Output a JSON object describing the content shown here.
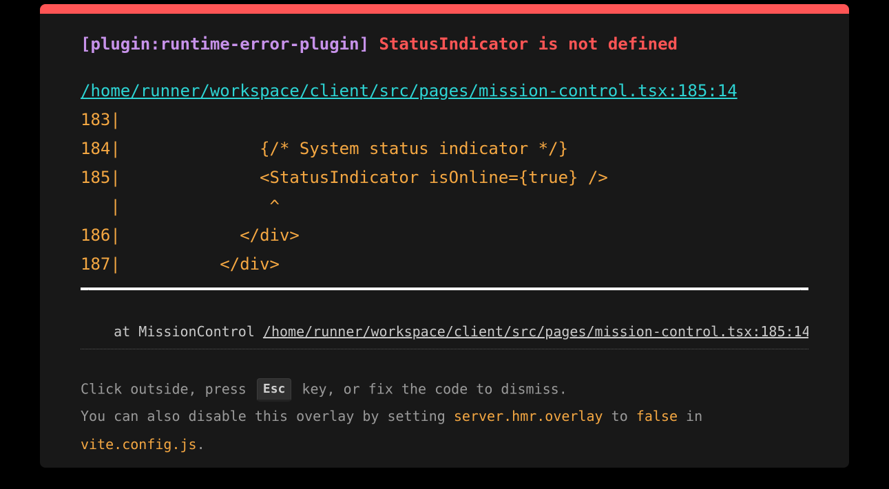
{
  "error": {
    "plugin": "[plugin:runtime-error-plugin]",
    "message": "StatusIndicator is not defined",
    "file": "/home/runner/workspace/client/src/pages/mission-control.tsx:185:14"
  },
  "frame_lines": [
    "183|",
    "184|              {/* System status indicator */}",
    "185|              <StatusIndicator isOnline={true} />",
    "   |               ^",
    "186|            </div>",
    "187|          </div>"
  ],
  "stack": {
    "prefix": "    at MissionControl ",
    "link": "/home/runner/workspace/client/src/pages/mission-control.tsx:185:14"
  },
  "tip": {
    "line1_before": "Click outside, press ",
    "key": "Esc",
    "line1_after": " key, or fix the code to dismiss.",
    "line2_before": "You can also disable this overlay by setting ",
    "line2_code1": "server.hmr.overlay",
    "line2_mid": " to ",
    "line2_code2": "false",
    "line2_after": " in",
    "line3_code": "vite.config.js",
    "line3_after": "."
  },
  "colors": {
    "accent": "#ff5555",
    "plugin": "#c792ea",
    "link": "#2dd4d4",
    "code": "#f4a742",
    "background": "#181818"
  }
}
